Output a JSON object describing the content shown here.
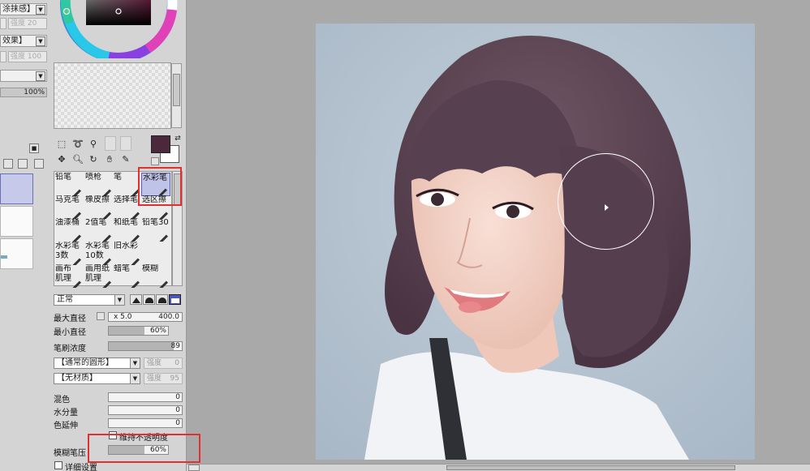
{
  "left_panel": {
    "rows": [
      "涂抹感】",
      "效果】"
    ],
    "density_label_1": "强度",
    "density_value_1": "20",
    "density_label_2": "强度",
    "density_value_2": "100",
    "opacity": "100%"
  },
  "brush_tools": [
    {
      "name": "铅笔",
      "selected": false
    },
    {
      "name": "喷枪",
      "selected": false
    },
    {
      "name": "笔",
      "selected": false
    },
    {
      "name": "水彩笔",
      "selected": true
    },
    {
      "name": "马克笔",
      "selected": false
    },
    {
      "name": "橡皮擦",
      "selected": false
    },
    {
      "name": "选择笔",
      "selected": false
    },
    {
      "name": "选区擦",
      "selected": false
    },
    {
      "name": "油漆桶",
      "selected": false
    },
    {
      "name": "2值笔",
      "selected": false
    },
    {
      "name": "和纸笔",
      "selected": false
    },
    {
      "name": "铅笔30",
      "selected": false
    },
    {
      "name": "水彩笔\n3数",
      "selected": false
    },
    {
      "name": "水彩笔\n10数",
      "selected": false
    },
    {
      "name": "旧水彩",
      "selected": false
    },
    {
      "name": "",
      "selected": false
    },
    {
      "name": "画布\n肌理",
      "selected": false
    },
    {
      "name": "画用纸\n肌理",
      "selected": false
    },
    {
      "name": "蜡笔",
      "selected": false
    },
    {
      "name": "模糊",
      "selected": false
    }
  ],
  "brush_settings": {
    "blend_mode": "正常",
    "max_size_label": "最大直径",
    "max_size_multiplier": "x 5.0",
    "max_size_value": "400.0",
    "min_size_label": "最小直径",
    "min_size_value": "60%",
    "min_size_fraction": 0.6,
    "density_label": "笔刷浓度",
    "density_value": "89",
    "density_fraction": 0.89,
    "shape_combo": "【通常的圆形】",
    "shape_strength_label": "强度",
    "shape_strength_value": "0",
    "texture_combo": "【无材质】",
    "texture_strength_label": "强度",
    "texture_strength_value": "95",
    "blending_label": "混色",
    "blending_value": "0",
    "water_label": "水分量",
    "water_value": "0",
    "color_extend_label": "色延伸",
    "color_extend_value": "0",
    "keep_opacity_label": "维持不透明度",
    "blur_pressure_label": "模糊笔压",
    "blur_pressure_value": "60%",
    "blur_pressure_fraction": 0.6,
    "advanced_label": "详细设置"
  },
  "colors": {
    "foreground": "#4a2a3a",
    "background": "#ffffff",
    "selected_tool": "#c0c3e8",
    "highlight": "#e03030"
  },
  "icons": [
    "rect-select-icon",
    "lasso-icon",
    "magic-wand-icon",
    "move-icon",
    "zoom-icon",
    "rotate-icon",
    "hand-icon",
    "eyedropper-icon"
  ]
}
